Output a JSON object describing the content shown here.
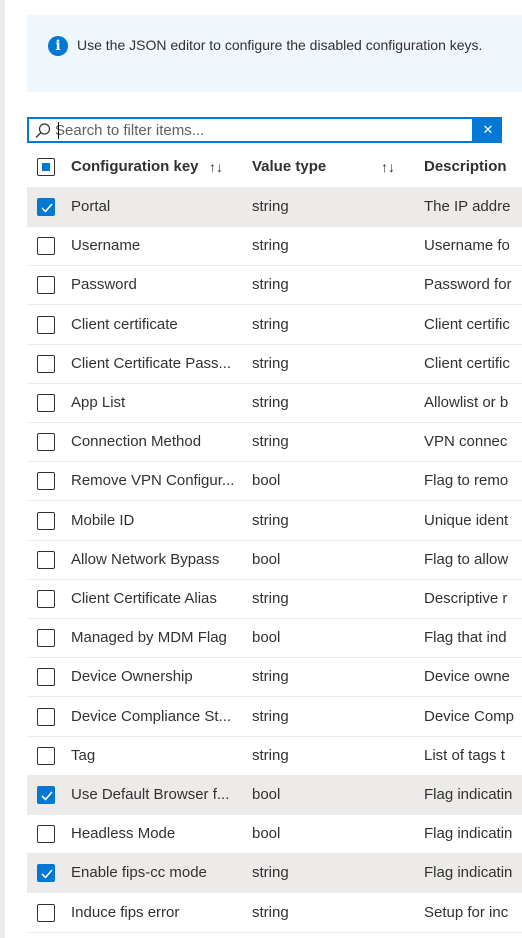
{
  "info": {
    "icon": "info-icon",
    "text": "Use the JSON editor to configure the disabled configuration keys."
  },
  "search": {
    "placeholder": "Search to filter items...",
    "clear_icon": "close-icon"
  },
  "table": {
    "select_all_state": "partial",
    "headers": {
      "key": "Configuration key",
      "type": "Value type",
      "description": "Description"
    },
    "sort_glyph": "↑↓",
    "rows": [
      {
        "key": "Portal",
        "type": "string",
        "description": "The IP addre",
        "checked": true
      },
      {
        "key": "Username",
        "type": "string",
        "description": "Username fo",
        "checked": false
      },
      {
        "key": "Password",
        "type": "string",
        "description": "Password for",
        "checked": false
      },
      {
        "key": "Client certificate",
        "type": "string",
        "description": "Client certific",
        "checked": false
      },
      {
        "key": "Client Certificate Pass...",
        "type": "string",
        "description": "Client certific",
        "checked": false
      },
      {
        "key": "App List",
        "type": "string",
        "description": "Allowlist or b",
        "checked": false
      },
      {
        "key": "Connection Method",
        "type": "string",
        "description": "VPN connec",
        "checked": false
      },
      {
        "key": "Remove VPN Configur...",
        "type": "bool",
        "description": "Flag to remo",
        "checked": false
      },
      {
        "key": "Mobile ID",
        "type": "string",
        "description": "Unique ident",
        "checked": false
      },
      {
        "key": "Allow Network Bypass",
        "type": "bool",
        "description": "Flag to allow",
        "checked": false
      },
      {
        "key": "Client Certificate Alias",
        "type": "string",
        "description": "Descriptive r",
        "checked": false
      },
      {
        "key": "Managed by MDM Flag",
        "type": "bool",
        "description": "Flag that ind",
        "checked": false
      },
      {
        "key": "Device Ownership",
        "type": "string",
        "description": "Device owne",
        "checked": false
      },
      {
        "key": "Device Compliance St...",
        "type": "string",
        "description": "Device Comp",
        "checked": false
      },
      {
        "key": "Tag",
        "type": "string",
        "description": "List of tags t",
        "checked": false
      },
      {
        "key": "Use Default Browser f...",
        "type": "bool",
        "description": "Flag indicatin",
        "checked": true
      },
      {
        "key": "Headless Mode",
        "type": "bool",
        "description": "Flag indicatin",
        "checked": false
      },
      {
        "key": "Enable fips-cc mode",
        "type": "string",
        "description": "Flag indicatin",
        "checked": true
      },
      {
        "key": "Induce fips error",
        "type": "string",
        "description": "Setup for inc",
        "checked": false
      }
    ]
  }
}
